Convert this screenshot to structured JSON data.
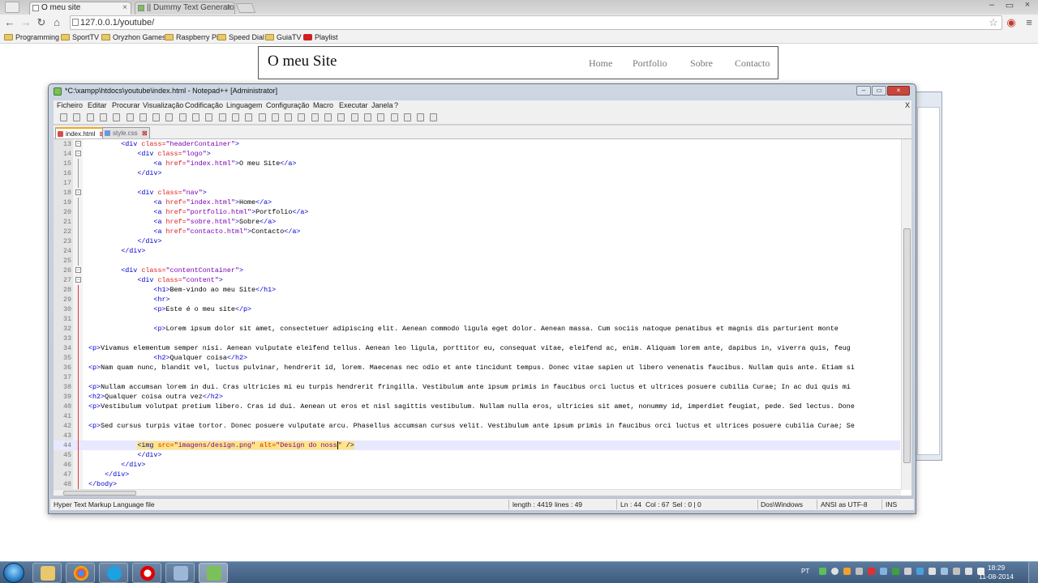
{
  "browser": {
    "tabs": [
      {
        "label": "O meu site",
        "active": true
      },
      {
        "label": "|| Dummy Text Generator |",
        "active": false
      }
    ],
    "address": "127.0.0.1/youtube/",
    "bookmarks": [
      {
        "label": "Programming",
        "icon": "folder-icon"
      },
      {
        "label": "SportTV",
        "icon": "folder-icon"
      },
      {
        "label": "Oryzhon Games",
        "icon": "folder-icon"
      },
      {
        "label": "Raspberry Pi",
        "icon": "folder-icon"
      },
      {
        "label": "Speed Dial",
        "icon": "folder-icon"
      },
      {
        "label": "GuiaTV",
        "icon": "folder-icon"
      },
      {
        "label": "Playlist",
        "icon": "youtube-icon"
      }
    ]
  },
  "site": {
    "logo": "O meu Site",
    "nav": [
      "Home",
      "Portfolio",
      "Sobre",
      "Contacto"
    ]
  },
  "npp": {
    "title": "*C:\\xampp\\htdocs\\youtube\\index.html - Notepad++ [Administrator]",
    "menu": [
      "Ficheiro",
      "Editar",
      "Procurar",
      "Visualização",
      "Codificação",
      "Linguagem",
      "Configuração",
      "Macro",
      "Executar",
      "Janela",
      "?"
    ],
    "menu_close": "X",
    "files": [
      {
        "label": "index.html",
        "active": true
      },
      {
        "label": "style.css",
        "active": false
      }
    ],
    "lines": [
      {
        "n": "13",
        "i": "        ",
        "h": "<span class='t'>&lt;div</span> <span class='a'>class=</span><span class='s'>\"headerContainer\"</span><span class='t'>&gt;</span>"
      },
      {
        "n": "14",
        "i": "            ",
        "h": "<span class='t'>&lt;div</span> <span class='a'>class=</span><span class='s'>\"logo\"</span><span class='t'>&gt;</span>"
      },
      {
        "n": "15",
        "i": "                ",
        "h": "<span class='t'>&lt;a</span> <span class='a'>href=</span><span class='s'>\"index.html\"</span><span class='t'>&gt;</span>O meu Site<span class='t'>&lt;/a&gt;</span>"
      },
      {
        "n": "16",
        "i": "            ",
        "h": "<span class='t'>&lt;/div&gt;</span>"
      },
      {
        "n": "17",
        "i": "",
        "h": ""
      },
      {
        "n": "18",
        "i": "            ",
        "h": "<span class='t'>&lt;div</span> <span class='a'>class=</span><span class='s'>\"nav\"</span><span class='t'>&gt;</span>"
      },
      {
        "n": "19",
        "i": "                ",
        "h": "<span class='t'>&lt;a</span> <span class='a'>href=</span><span class='s'>\"index.html\"</span><span class='t'>&gt;</span>Home<span class='t'>&lt;/a&gt;</span>"
      },
      {
        "n": "20",
        "i": "                ",
        "h": "<span class='t'>&lt;a</span> <span class='a'>href=</span><span class='s'>\"portfolio.html\"</span><span class='t'>&gt;</span>Portfolio<span class='t'>&lt;/a&gt;</span>"
      },
      {
        "n": "21",
        "i": "                ",
        "h": "<span class='t'>&lt;a</span> <span class='a'>href=</span><span class='s'>\"sobre.html\"</span><span class='t'>&gt;</span>Sobre<span class='t'>&lt;/a&gt;</span>"
      },
      {
        "n": "22",
        "i": "                ",
        "h": "<span class='t'>&lt;a</span> <span class='a'>href=</span><span class='s'>\"contacto.html\"</span><span class='t'>&gt;</span>Contacto<span class='t'>&lt;/a&gt;</span>"
      },
      {
        "n": "23",
        "i": "            ",
        "h": "<span class='t'>&lt;/div&gt;</span>"
      },
      {
        "n": "24",
        "i": "        ",
        "h": "<span class='t'>&lt;/div&gt;</span>"
      },
      {
        "n": "25",
        "i": "",
        "h": ""
      },
      {
        "n": "26",
        "i": "        ",
        "h": "<span class='t'>&lt;div</span> <span class='a'>class=</span><span class='s'>\"contentContainer\"</span><span class='t'>&gt;</span>"
      },
      {
        "n": "27",
        "i": "            ",
        "h": "<span class='t'>&lt;div</span> <span class='a'>class=</span><span class='s'>\"content\"</span><span class='t'>&gt;</span>"
      },
      {
        "n": "28",
        "i": "                ",
        "h": "<span class='t'>&lt;h1&gt;</span>Bem-vindo ao meu Site<span class='t'>&lt;/h1&gt;</span>"
      },
      {
        "n": "29",
        "i": "                ",
        "h": "<span class='t'>&lt;hr&gt;</span>"
      },
      {
        "n": "30",
        "i": "                ",
        "h": "<span class='t'>&lt;p&gt;</span>Este é o meu site<span class='t'>&lt;/p&gt;</span>"
      },
      {
        "n": "31",
        "i": "",
        "h": ""
      },
      {
        "n": "32",
        "i": "                ",
        "h": "<span class='t'>&lt;p&gt;</span>Lorem ipsum dolor sit amet, consectetuer adipiscing elit. Aenean commodo ligula eget dolor. Aenean massa. Cum sociis natoque penatibus et magnis dis parturient monte"
      },
      {
        "n": "33",
        "i": "",
        "h": ""
      },
      {
        "n": "34",
        "i": "",
        "h": "<span class='t'>&lt;p&gt;</span>Vivamus elementum semper nisi. Aenean vulputate eleifend tellus. Aenean leo ligula, porttitor eu, consequat vitae, eleifend ac, enim. Aliquam lorem ante, dapibus in, viverra quis, feug"
      },
      {
        "n": "35",
        "i": "                ",
        "h": "<span class='t'>&lt;h2&gt;</span>Qualquer coisa<span class='t'>&lt;/h2&gt;</span>"
      },
      {
        "n": "36",
        "i": "",
        "h": "<span class='t'>&lt;p&gt;</span>Nam quam nunc, blandit vel, luctus pulvinar, hendrerit id, lorem. Maecenas nec odio et ante tincidunt tempus. Donec vitae sapien ut libero venenatis faucibus. Nullam quis ante. Etiam si"
      },
      {
        "n": "37",
        "i": "",
        "h": ""
      },
      {
        "n": "38",
        "i": "",
        "h": "<span class='t'>&lt;p&gt;</span>Nullam accumsan lorem in dui. Cras ultricies mi eu turpis hendrerit fringilla. Vestibulum ante ipsum primis in faucibus orci luctus et ultrices posuere cubilia Curae; In ac dui quis mi"
      },
      {
        "n": "39",
        "i": "",
        "h": "<span class='t'>&lt;h2&gt;</span>Qualquer coisa outra vez<span class='t'>&lt;/h2&gt;</span>"
      },
      {
        "n": "40",
        "i": "",
        "h": "<span class='t'>&lt;p&gt;</span>Vestibulum volutpat pretium libero. Cras id dui. Aenean ut eros et nisl sagittis vestibulum. Nullam nulla eros, ultricies sit amet, nonummy id, imperdiet feugiat, pede. Sed lectus. Done"
      },
      {
        "n": "41",
        "i": "",
        "h": ""
      },
      {
        "n": "42",
        "i": "",
        "h": "<span class='t'>&lt;p&gt;</span>Sed cursus turpis vitae tortor. Donec posuere vulputate arcu. Phasellus accumsan cursus velit. Vestibulum ante ipsum primis in faucibus orci luctus et ultrices posuere cubilia Curae; Se"
      },
      {
        "n": "43",
        "i": "",
        "h": ""
      },
      {
        "n": "44",
        "i": "            ",
        "h": "<span class='sel'><span class='t'>&lt;img</span> <span class='a'>src=</span><span class='s'>\"imagens/design.png\"</span> <span class='a'>alt=</span><span class='s'>\"Design do noss</span></span><span class='cursorbar'></span><span class='sel'><span class='s'>\"</span> <span class='t'>/&gt;</span></span>",
        "current": true
      },
      {
        "n": "45",
        "i": "            ",
        "h": "<span class='t'>&lt;/div&gt;</span>"
      },
      {
        "n": "46",
        "i": "        ",
        "h": "<span class='t'>&lt;/div&gt;</span>"
      },
      {
        "n": "47",
        "i": "    ",
        "h": "<span class='t'>&lt;/div&gt;</span>"
      },
      {
        "n": "48",
        "i": "",
        "h": "<span class='t'>&lt;/body&gt;</span>"
      }
    ],
    "status": {
      "type": "Hyper Text Markup Language file",
      "length": "length : 4419",
      "lines": "lines : 49",
      "ln": "Ln : 44",
      "col": "Col : 67",
      "sel": "Sel : 0 | 0",
      "eol": "Dos\\Windows",
      "enc": "ANSI as UTF-8",
      "ins": "INS"
    }
  },
  "taskbar": {
    "lang": "PT",
    "time": "18:29",
    "date": "11-08-2014"
  }
}
